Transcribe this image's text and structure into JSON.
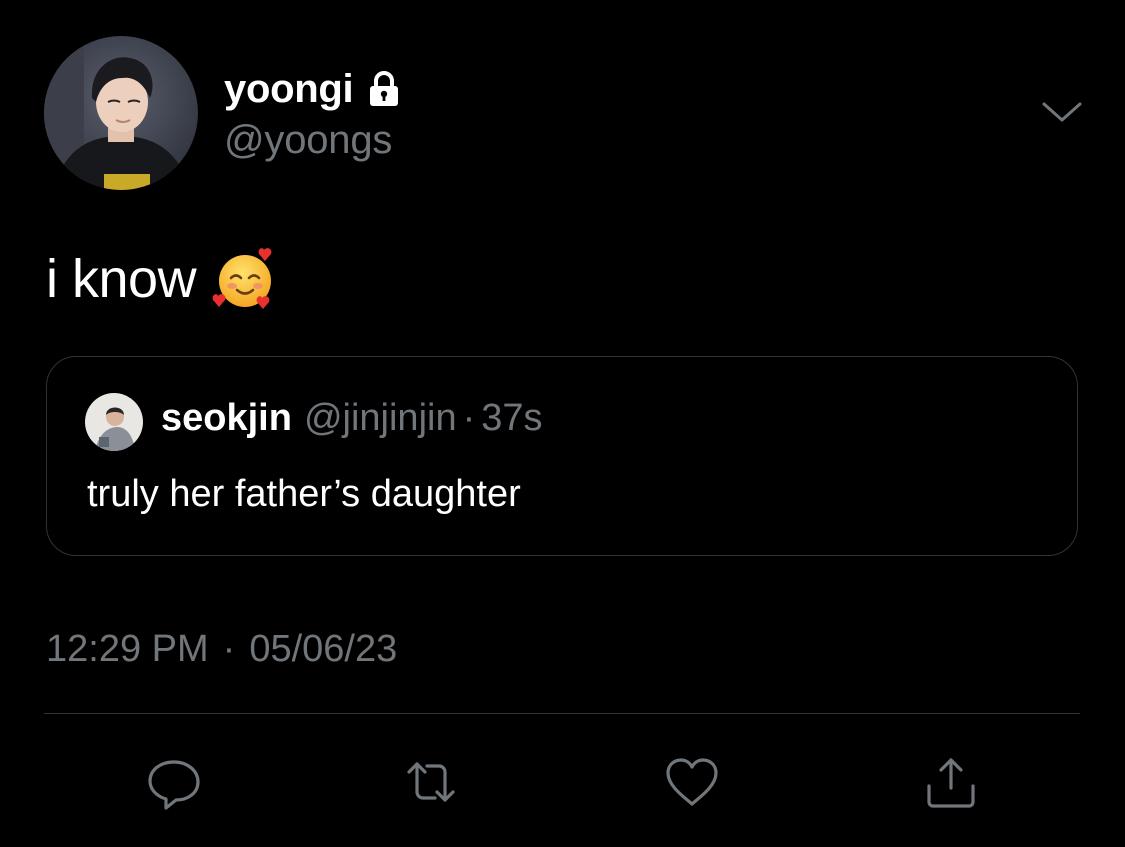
{
  "author": {
    "display_name": "yoongi",
    "handle": "@yoongs",
    "avatar_icon": "profile-photo",
    "protected_icon": "lock-icon"
  },
  "tweet": {
    "text": "i know",
    "emoji": "smiling-face-with-hearts"
  },
  "quoted_tweet": {
    "display_name": "seokjin",
    "handle": "@jinjinjin",
    "separator": "·",
    "time_ago": "37s",
    "text": "truly her father’s daughter"
  },
  "meta": {
    "time": "12:29 PM",
    "separator": "·",
    "date": "05/06/23"
  },
  "actions": [
    "reply-icon",
    "retweet-icon",
    "like-icon",
    "share-icon"
  ],
  "colors": {
    "background": "#000000",
    "text": "#ffffff",
    "secondary_text": "#71767b",
    "border": "#2f3336"
  }
}
